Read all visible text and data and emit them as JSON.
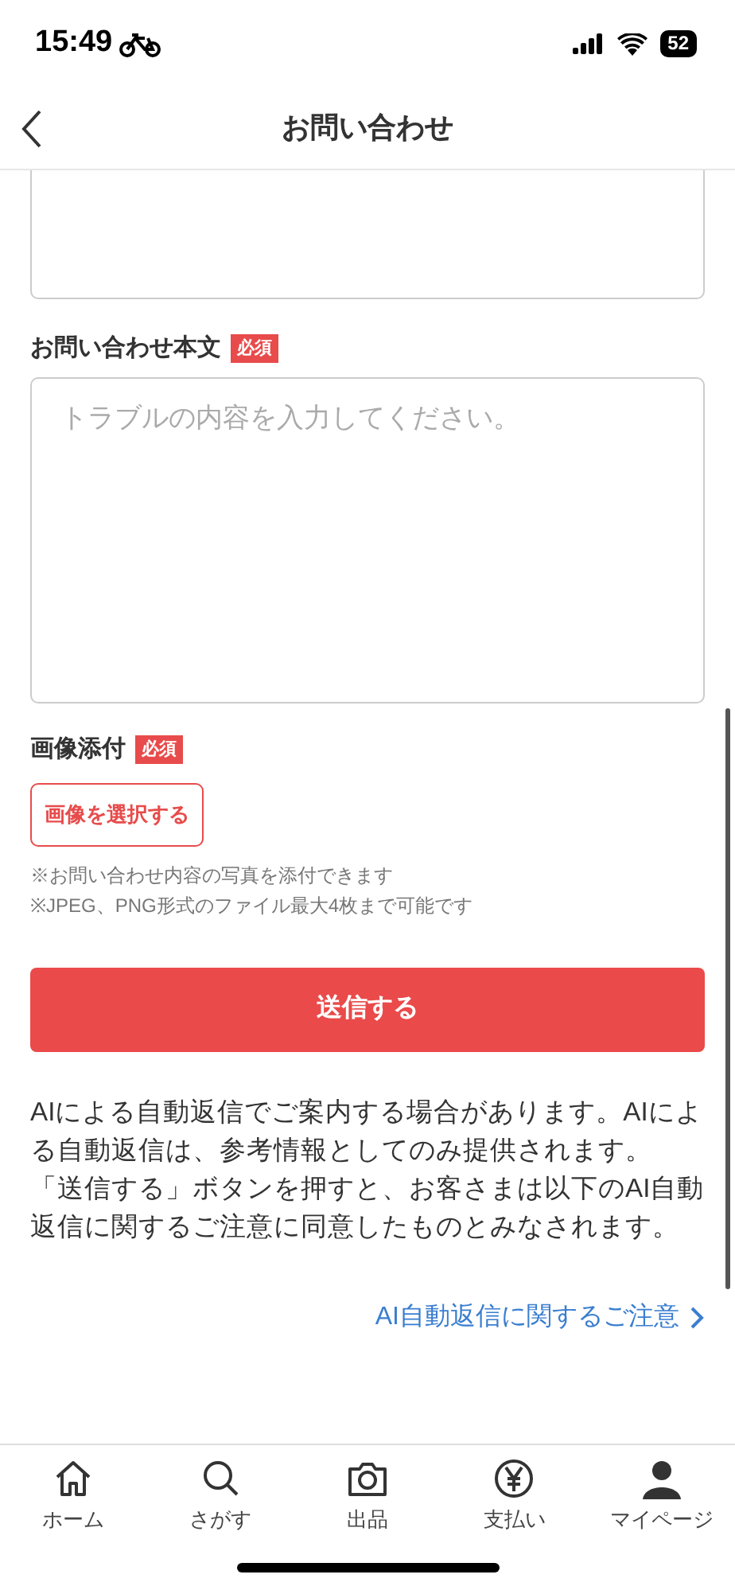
{
  "status_bar": {
    "time": "15:49",
    "battery": "52"
  },
  "header": {
    "title": "お問い合わせ"
  },
  "form": {
    "body_field": {
      "label": "お問い合わせ本文",
      "required_badge": "必須",
      "placeholder": "トラブルの内容を入力してください。"
    },
    "image_field": {
      "label": "画像添付",
      "required_badge": "必須",
      "button": "画像を選択する",
      "notes": [
        "※お問い合わせ内容の写真を添付できます",
        "※JPEG、PNG形式のファイル最大4枚まで可能です"
      ]
    },
    "submit": "送信する",
    "disclaimer": "AIによる自動返信でご案内する場合があります。AIによる自動返信は、参考情報としてのみ提供されます。「送信する」ボタンを押すと、お客さまは以下のAI自動返信に関するご注意に同意したものとみなされます。",
    "notice_link": "AI自動返信に関するご注意"
  },
  "tab_bar": [
    {
      "kind": "home",
      "label": "ホーム"
    },
    {
      "kind": "search",
      "label": "さがす"
    },
    {
      "kind": "camera",
      "label": "出品"
    },
    {
      "kind": "yen",
      "label": "支払い"
    },
    {
      "kind": "person",
      "label": "マイページ"
    }
  ]
}
